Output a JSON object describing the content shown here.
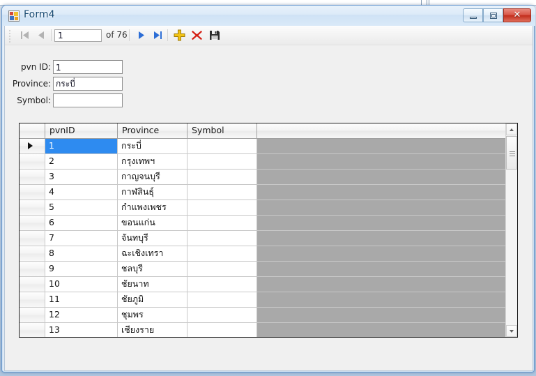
{
  "window": {
    "title": "Form4",
    "icon": "winforms-icon",
    "controls": {
      "minimize": "minimize-icon",
      "maximize": "maximize-icon",
      "close": "✕"
    }
  },
  "toolbar": {
    "move_first_label": "move-first-icon",
    "move_previous_label": "move-previous-icon",
    "position_value": "1",
    "position_placeholder": "",
    "count_label": "of 76",
    "move_next_label": "move-next-icon",
    "move_last_label": "move-last-icon",
    "add_label": "add-new-icon",
    "delete_label": "delete-icon",
    "save_label": "save-icon"
  },
  "fields": [
    {
      "label": "pvn ID:",
      "value": "1",
      "name": "pvn-id"
    },
    {
      "label": "Province:",
      "value": "กระบี่",
      "name": "province"
    },
    {
      "label": "Symbol:",
      "value": "",
      "name": "symbol"
    }
  ],
  "grid": {
    "columns": [
      "pvnID",
      "Province",
      "Symbol"
    ],
    "selected_row_index": 0,
    "rows": [
      {
        "pvnID": "1",
        "Province": "กระบี่",
        "Symbol": ""
      },
      {
        "pvnID": "2",
        "Province": "กรุงเทพฯ",
        "Symbol": ""
      },
      {
        "pvnID": "3",
        "Province": "กาญจนบุรี",
        "Symbol": ""
      },
      {
        "pvnID": "4",
        "Province": "กาฬสินธุ์",
        "Symbol": ""
      },
      {
        "pvnID": "5",
        "Province": "กำแพงเพชร",
        "Symbol": ""
      },
      {
        "pvnID": "6",
        "Province": "ขอนแก่น",
        "Symbol": ""
      },
      {
        "pvnID": "7",
        "Province": "จันทบุรี",
        "Symbol": ""
      },
      {
        "pvnID": "8",
        "Province": "ฉะเชิงเทรา",
        "Symbol": ""
      },
      {
        "pvnID": "9",
        "Province": "ชลบุรี",
        "Symbol": ""
      },
      {
        "pvnID": "10",
        "Province": "ชัยนาท",
        "Symbol": ""
      },
      {
        "pvnID": "11",
        "Province": "ชัยภูมิ",
        "Symbol": ""
      },
      {
        "pvnID": "12",
        "Province": "ชุมพร",
        "Symbol": ""
      },
      {
        "pvnID": "13",
        "Province": "เชียงราย",
        "Symbol": ""
      }
    ]
  },
  "colors": {
    "selection": "#2e8bf0",
    "filler": "#a9a9a9",
    "form_background": "#f0f0f0",
    "close_button": "#c22d1c",
    "title_text": "#184a72"
  }
}
